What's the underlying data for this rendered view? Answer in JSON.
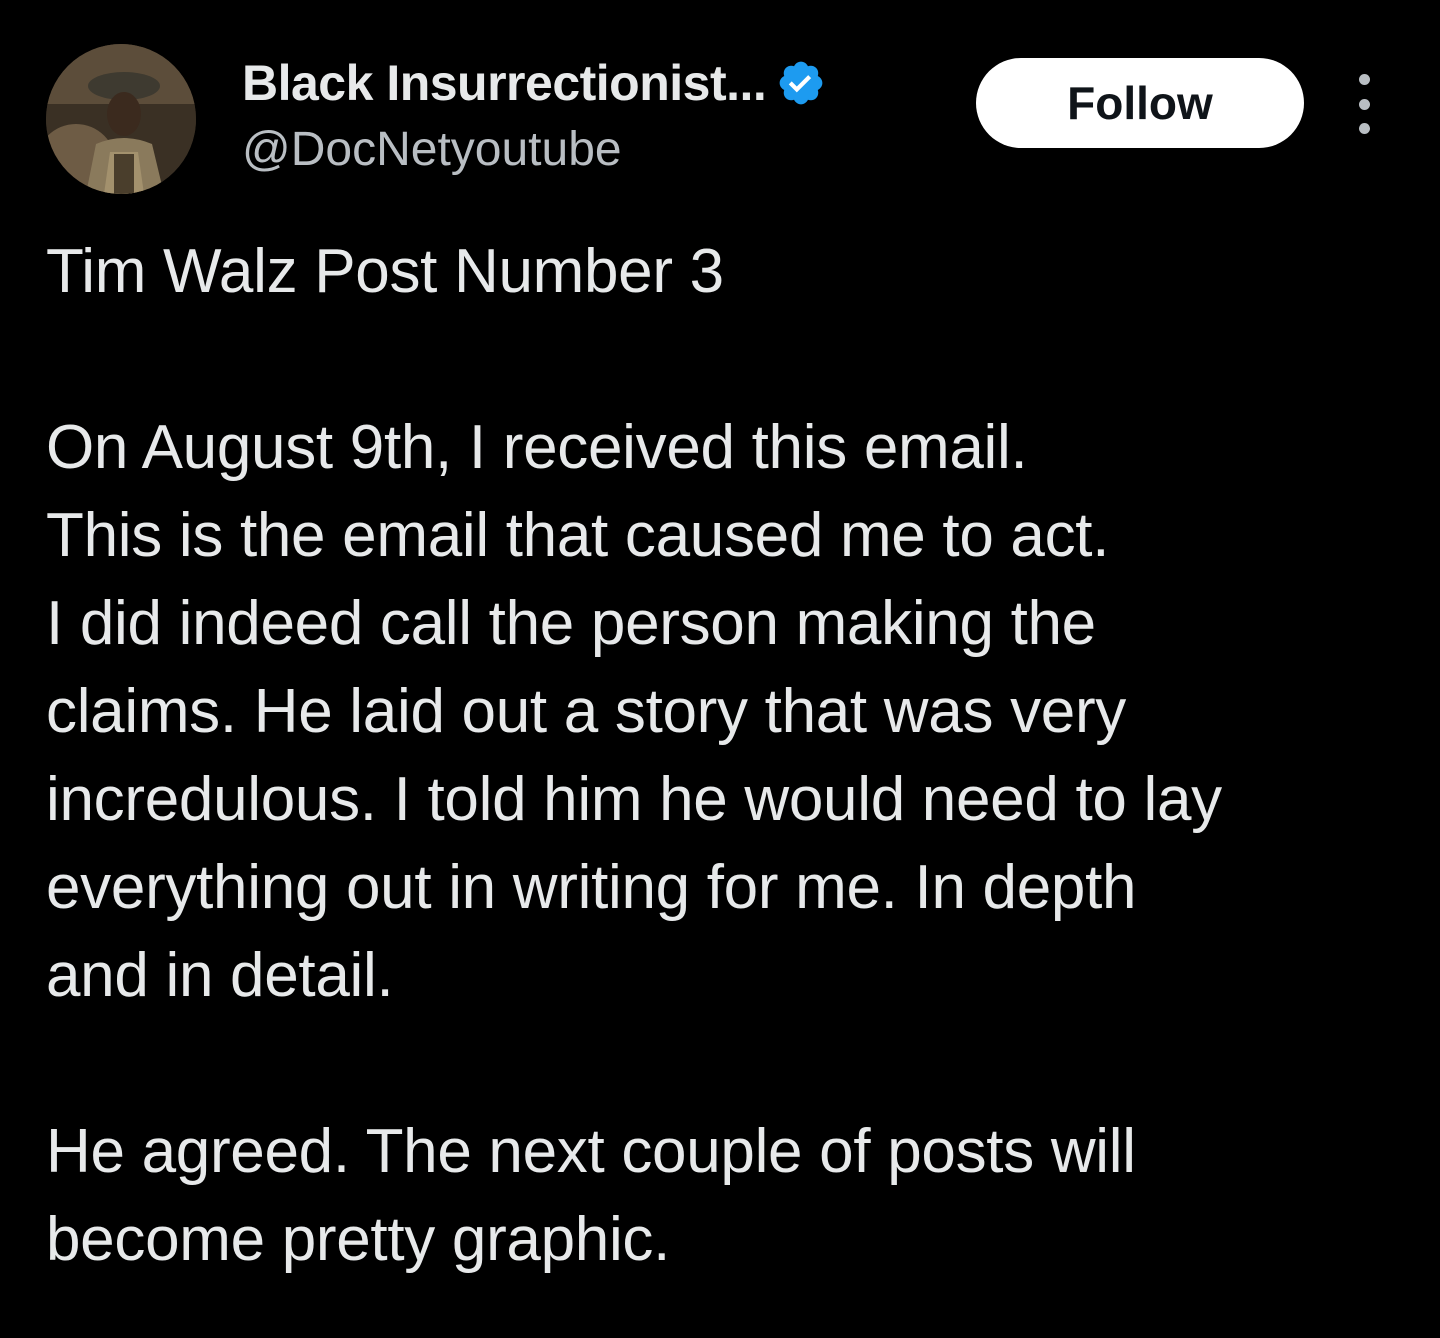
{
  "author": {
    "display_name": "Black Insurrectionist...",
    "handle": "@DocNetyoutube",
    "verified": true,
    "avatar_icon": "profile-photo-soldier"
  },
  "actions": {
    "follow_label": "Follow",
    "more_icon": "more-vertical-icon"
  },
  "post": {
    "title": "Tim Walz Post Number 3",
    "paragraph_1_lines": [
      "On August 9th, I received this email.",
      "This is the email that caused me to act.",
      "I did indeed call the person making the",
      "claims. He laid out a story that was very",
      "incredulous. I told him he would need to lay",
      "everything out in writing for me. In depth",
      "and in detail."
    ],
    "paragraph_2_lines": [
      "He agreed. The next couple of posts will",
      "become pretty graphic."
    ]
  },
  "colors": {
    "background": "#000000",
    "text_primary": "#e7e9ea",
    "text_secondary": "#b9bec3",
    "verified_blue": "#1d9bf0",
    "follow_bg": "#ffffff"
  }
}
